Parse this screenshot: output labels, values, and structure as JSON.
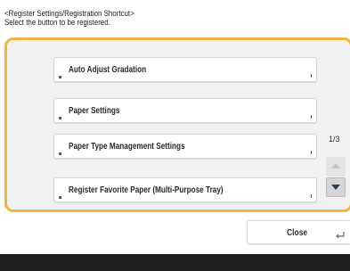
{
  "header": {
    "title": "<Register Settings/Registration Shortcut>",
    "instruction": "Select the button to be registered."
  },
  "items": [
    {
      "label": "Auto Adjust Gradation"
    },
    {
      "label": "Paper Settings"
    },
    {
      "label": "Paper Type Management Settings"
    },
    {
      "label": "Register Favorite Paper (Multi-Purpose Tray)"
    }
  ],
  "pagination": {
    "indicator": "1/3"
  },
  "footer": {
    "close_label": "Close"
  },
  "colors": {
    "panel_border": "#f5b53a",
    "panel_background": "#f1f1f1",
    "bottom_bar": "#1f1f1f"
  }
}
